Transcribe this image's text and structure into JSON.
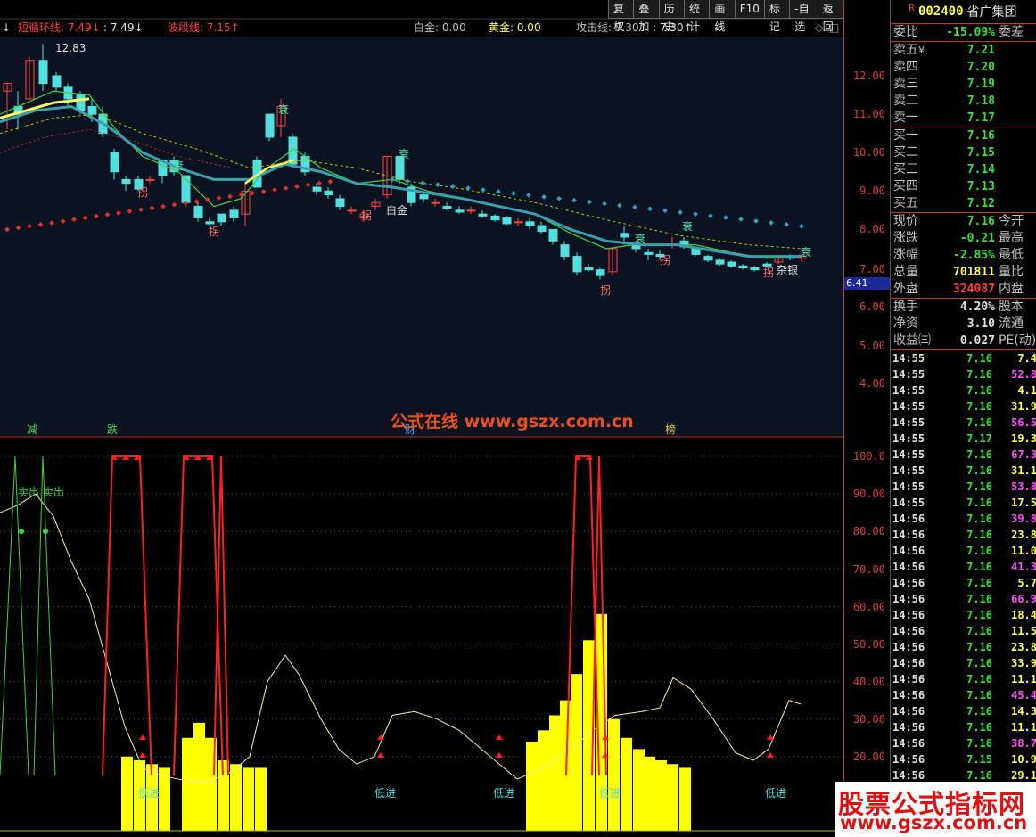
{
  "toolbar": {
    "items": [
      "复权",
      "叠加",
      "历史",
      "统计",
      "画线",
      "F10",
      "标记",
      "-自选",
      "返回"
    ]
  },
  "indicators": {
    "short_cycle_label": "短循环线: 7.49↓",
    "short_cycle_second": ": 7.49↓",
    "wave_label": "波段线: 7.15↑",
    "baijin": "白金: 0.00",
    "huangjin": "黄金: 0.00",
    "attack_label": "攻击线: 7.30↑",
    "attack_second": ": 7.30↑"
  },
  "main_chart": {
    "high_label": "12.83",
    "annotations": [
      "衰",
      "衰",
      "衰",
      "衰",
      "衰",
      "衰",
      "拐",
      "拐",
      "拐",
      "拐",
      "拐",
      "白金",
      "杂银"
    ],
    "bottom_labels": [
      "减",
      "跌",
      "财",
      "榜"
    ]
  },
  "price_axis": {
    "ticks": [
      "12.00",
      "11.00",
      "10.00",
      "9.00",
      "8.00",
      "7.00",
      "6.00",
      "5.00",
      "4.00"
    ],
    "current_flag": "6.41"
  },
  "osc_axis": {
    "ticks": [
      "100.0",
      "90.00",
      "80.00",
      "70.00",
      "60.00",
      "50.00",
      "40.00",
      "30.00",
      "20.00"
    ]
  },
  "oscillator": {
    "sell_labels": [
      "卖出",
      "卖出"
    ],
    "buy_labels": [
      "低进",
      "低进",
      "低进",
      "低进",
      "低进"
    ]
  },
  "stock": {
    "flag": "R",
    "code": "002400",
    "name": "省广集团"
  },
  "quote": {
    "webi_label": "委比",
    "webi_value": "-15.09%",
    "weicha_label": "委差",
    "asks": [
      {
        "label": "卖五",
        "mark": "¥",
        "price": "7.21"
      },
      {
        "label": "卖四",
        "mark": "",
        "price": "7.20"
      },
      {
        "label": "卖三",
        "mark": "",
        "price": "7.19"
      },
      {
        "label": "卖二",
        "mark": "",
        "price": "7.18"
      },
      {
        "label": "卖一",
        "mark": "",
        "price": "7.17"
      }
    ],
    "bids": [
      {
        "label": "买一",
        "price": "7.16"
      },
      {
        "label": "买二",
        "price": "7.15"
      },
      {
        "label": "买三",
        "price": "7.14"
      },
      {
        "label": "买四",
        "price": "7.13"
      },
      {
        "label": "买五",
        "price": "7.12"
      }
    ],
    "stats1": [
      {
        "label": "现价",
        "value": "7.16",
        "label2": "今开"
      },
      {
        "label": "涨跌",
        "value": "-0.21",
        "label2": "最高"
      },
      {
        "label": "涨幅",
        "value": "-2.85%",
        "label2": "最低"
      },
      {
        "label": "总量",
        "value": "701811",
        "label2": "量比"
      },
      {
        "label": "外盘",
        "value": "324087",
        "label2": "内盘"
      }
    ],
    "stats2": [
      {
        "label": "换手",
        "value": "4.20%",
        "label2": "股本"
      },
      {
        "label": "净资",
        "value": "3.10",
        "label2": "流通"
      },
      {
        "label": "收益㈢",
        "value": "0.027",
        "label2": "PE(动)"
      }
    ]
  },
  "ticks": [
    {
      "t": "14:55",
      "p": "7.16",
      "v": "7.4",
      "vc": "yellow"
    },
    {
      "t": "14:55",
      "p": "7.16",
      "v": "52.8",
      "vc": "magenta"
    },
    {
      "t": "14:55",
      "p": "7.16",
      "v": "4.1",
      "vc": "yellow"
    },
    {
      "t": "14:55",
      "p": "7.16",
      "v": "31.9",
      "vc": "yellow"
    },
    {
      "t": "14:55",
      "p": "7.16",
      "v": "56.5",
      "vc": "magenta"
    },
    {
      "t": "14:55",
      "p": "7.17",
      "v": "19.3",
      "vc": "yellow"
    },
    {
      "t": "14:55",
      "p": "7.16",
      "v": "67.3",
      "vc": "magenta"
    },
    {
      "t": "14:55",
      "p": "7.16",
      "v": "31.1",
      "vc": "yellow"
    },
    {
      "t": "14:55",
      "p": "7.16",
      "v": "53.8",
      "vc": "magenta"
    },
    {
      "t": "14:55",
      "p": "7.16",
      "v": "17.5",
      "vc": "yellow"
    },
    {
      "t": "14:56",
      "p": "7.16",
      "v": "39.8",
      "vc": "magenta"
    },
    {
      "t": "14:56",
      "p": "7.16",
      "v": "23.8",
      "vc": "yellow"
    },
    {
      "t": "14:56",
      "p": "7.16",
      "v": "11.0",
      "vc": "yellow"
    },
    {
      "t": "14:56",
      "p": "7.16",
      "v": "41.3",
      "vc": "magenta"
    },
    {
      "t": "14:56",
      "p": "7.16",
      "v": "5.7",
      "vc": "yellow"
    },
    {
      "t": "14:56",
      "p": "7.16",
      "v": "66.9",
      "vc": "magenta"
    },
    {
      "t": "14:56",
      "p": "7.16",
      "v": "18.4",
      "vc": "yellow"
    },
    {
      "t": "14:56",
      "p": "7.16",
      "v": "11.5",
      "vc": "yellow"
    },
    {
      "t": "14:56",
      "p": "7.16",
      "v": "23.8",
      "vc": "yellow"
    },
    {
      "t": "14:56",
      "p": "7.16",
      "v": "33.9",
      "vc": "yellow"
    },
    {
      "t": "14:56",
      "p": "7.16",
      "v": "11.1",
      "vc": "yellow"
    },
    {
      "t": "14:56",
      "p": "7.16",
      "v": "45.4",
      "vc": "magenta"
    },
    {
      "t": "14:56",
      "p": "7.16",
      "v": "14.3",
      "vc": "yellow"
    },
    {
      "t": "14:56",
      "p": "7.16",
      "v": "11.1",
      "vc": "yellow"
    },
    {
      "t": "14:56",
      "p": "7.16",
      "v": "38.7",
      "vc": "magenta"
    },
    {
      "t": "14:56",
      "p": "7.15",
      "v": "10.9",
      "vc": "yellow"
    },
    {
      "t": "14:56",
      "p": "7.16",
      "v": "29.1",
      "vc": "yellow"
    }
  ],
  "watermarks": {
    "center": "公式在线 www.gszx.com.cn",
    "corner_top": "股票公式指标网",
    "corner_bottom": "www.gszx.com.cn"
  },
  "colors": {
    "up": "#ff4040",
    "down": "#50e0e0",
    "ma_yellow": "#ffff60",
    "ma_green": "#40d040",
    "ma_teal": "#3aa0b0",
    "axis_red": "#c0392b"
  }
}
